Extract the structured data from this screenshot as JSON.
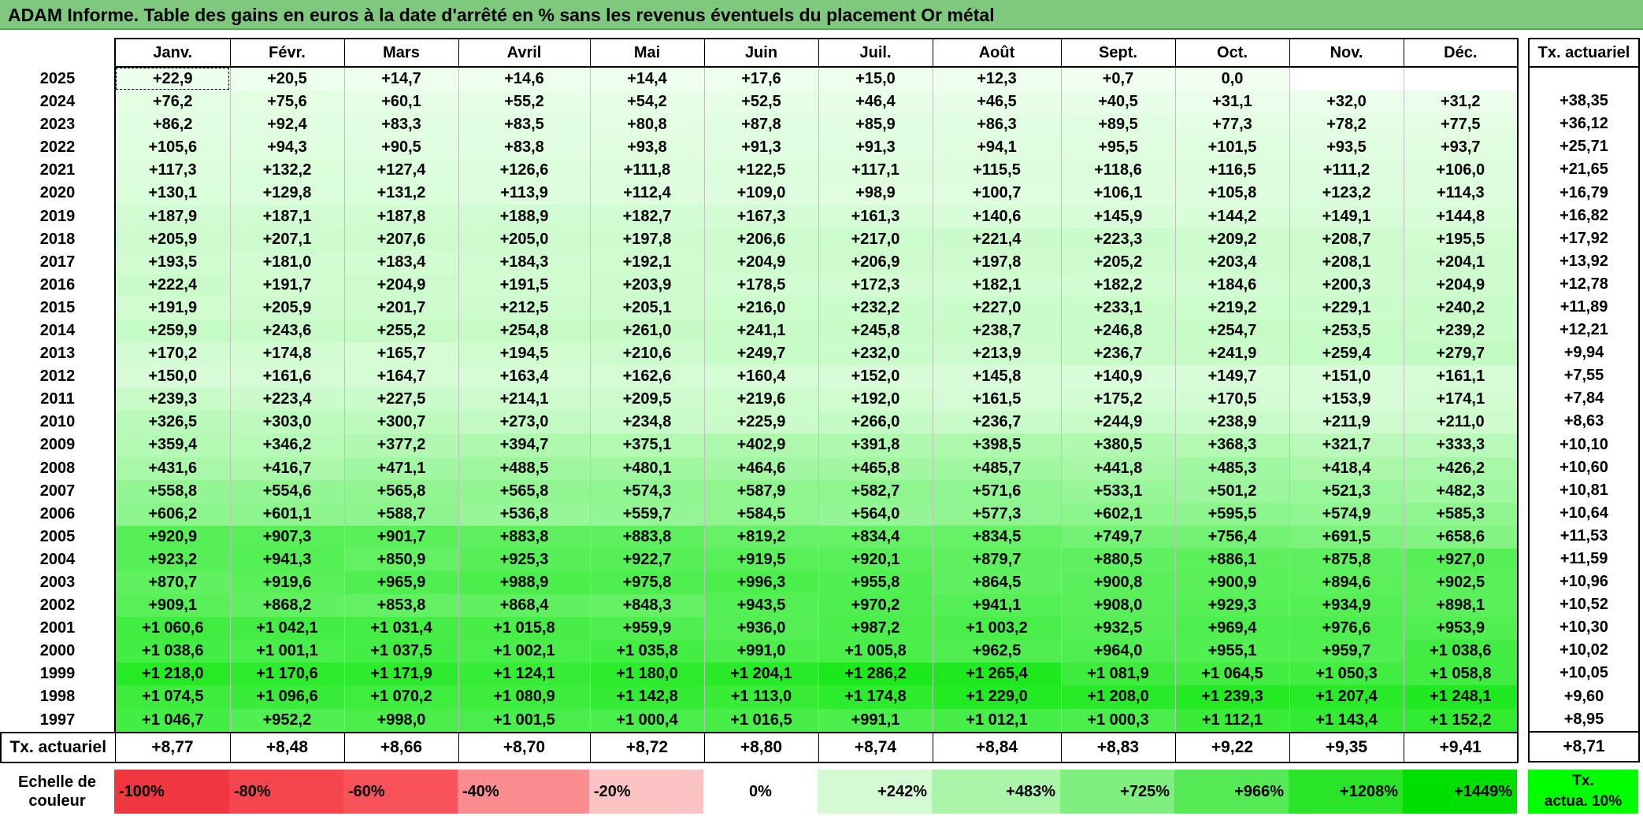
{
  "title": "ADAM Informe. Table des gains en euros à la date d'arrêté en % sans les revenus éventuels du placement Or métal",
  "months": [
    "Janv.",
    "Févr.",
    "Mars",
    "Avril",
    "Mai",
    "Juin",
    "Juil.",
    "Août",
    "Sept.",
    "Oct.",
    "Nov.",
    "Déc."
  ],
  "tx_header": "Tx. actuariel",
  "rows": [
    {
      "year": "2025",
      "v": [
        "+22,9",
        "+20,5",
        "+14,7",
        "+14,6",
        "+14,4",
        "+17,6",
        "+15,0",
        "+12,3",
        "+0,7",
        "0,0",
        "",
        ""
      ],
      "tx": ""
    },
    {
      "year": "2024",
      "v": [
        "+76,2",
        "+75,6",
        "+60,1",
        "+55,2",
        "+54,2",
        "+52,5",
        "+46,4",
        "+46,5",
        "+40,5",
        "+31,1",
        "+32,0",
        "+31,2"
      ],
      "tx": "+38,35"
    },
    {
      "year": "2023",
      "v": [
        "+86,2",
        "+92,4",
        "+83,3",
        "+83,5",
        "+80,8",
        "+87,8",
        "+85,9",
        "+86,3",
        "+89,5",
        "+77,3",
        "+78,2",
        "+77,5"
      ],
      "tx": "+36,12"
    },
    {
      "year": "2022",
      "v": [
        "+105,6",
        "+94,3",
        "+90,5",
        "+83,8",
        "+93,8",
        "+91,3",
        "+91,3",
        "+94,1",
        "+95,5",
        "+101,5",
        "+93,5",
        "+93,7"
      ],
      "tx": "+25,71"
    },
    {
      "year": "2021",
      "v": [
        "+117,3",
        "+132,2",
        "+127,4",
        "+126,6",
        "+111,8",
        "+122,5",
        "+117,1",
        "+115,5",
        "+118,6",
        "+116,5",
        "+111,2",
        "+106,0"
      ],
      "tx": "+21,65"
    },
    {
      "year": "2020",
      "v": [
        "+130,1",
        "+129,8",
        "+131,2",
        "+113,9",
        "+112,4",
        "+109,0",
        "+98,9",
        "+100,7",
        "+106,1",
        "+105,8",
        "+123,2",
        "+114,3"
      ],
      "tx": "+16,79"
    },
    {
      "year": "2019",
      "v": [
        "+187,9",
        "+187,1",
        "+187,8",
        "+188,9",
        "+182,7",
        "+167,3",
        "+161,3",
        "+140,6",
        "+145,9",
        "+144,2",
        "+149,1",
        "+144,8"
      ],
      "tx": "+16,82"
    },
    {
      "year": "2018",
      "v": [
        "+205,9",
        "+207,1",
        "+207,6",
        "+205,0",
        "+197,8",
        "+206,6",
        "+217,0",
        "+221,4",
        "+223,3",
        "+209,2",
        "+208,7",
        "+195,5"
      ],
      "tx": "+17,92"
    },
    {
      "year": "2017",
      "v": [
        "+193,5",
        "+181,0",
        "+183,4",
        "+184,3",
        "+192,1",
        "+204,9",
        "+206,9",
        "+197,8",
        "+205,2",
        "+203,4",
        "+208,1",
        "+204,1"
      ],
      "tx": "+13,92"
    },
    {
      "year": "2016",
      "v": [
        "+222,4",
        "+191,7",
        "+204,9",
        "+191,5",
        "+203,9",
        "+178,5",
        "+172,3",
        "+182,1",
        "+182,2",
        "+184,6",
        "+200,3",
        "+204,9"
      ],
      "tx": "+12,78"
    },
    {
      "year": "2015",
      "v": [
        "+191,9",
        "+205,9",
        "+201,7",
        "+212,5",
        "+205,1",
        "+216,0",
        "+232,2",
        "+227,0",
        "+233,1",
        "+219,2",
        "+229,1",
        "+240,2"
      ],
      "tx": "+11,89"
    },
    {
      "year": "2014",
      "v": [
        "+259,9",
        "+243,6",
        "+255,2",
        "+254,8",
        "+261,0",
        "+241,1",
        "+245,8",
        "+238,7",
        "+246,8",
        "+254,7",
        "+253,5",
        "+239,2"
      ],
      "tx": "+12,21"
    },
    {
      "year": "2013",
      "v": [
        "+170,2",
        "+174,8",
        "+165,7",
        "+194,5",
        "+210,6",
        "+249,7",
        "+232,0",
        "+213,9",
        "+236,7",
        "+241,9",
        "+259,4",
        "+279,7"
      ],
      "tx": "+9,94"
    },
    {
      "year": "2012",
      "v": [
        "+150,0",
        "+161,6",
        "+164,7",
        "+163,4",
        "+162,6",
        "+160,4",
        "+152,0",
        "+145,8",
        "+140,9",
        "+149,7",
        "+151,0",
        "+161,1"
      ],
      "tx": "+7,55"
    },
    {
      "year": "2011",
      "v": [
        "+239,3",
        "+223,4",
        "+227,5",
        "+214,1",
        "+209,5",
        "+219,6",
        "+192,0",
        "+161,5",
        "+175,2",
        "+170,5",
        "+153,9",
        "+174,1"
      ],
      "tx": "+7,84"
    },
    {
      "year": "2010",
      "v": [
        "+326,5",
        "+303,0",
        "+300,7",
        "+273,0",
        "+234,8",
        "+225,9",
        "+266,0",
        "+236,7",
        "+244,9",
        "+238,9",
        "+211,9",
        "+211,0"
      ],
      "tx": "+8,63"
    },
    {
      "year": "2009",
      "v": [
        "+359,4",
        "+346,2",
        "+377,2",
        "+394,7",
        "+375,1",
        "+402,9",
        "+391,8",
        "+398,5",
        "+380,5",
        "+368,3",
        "+321,7",
        "+333,3"
      ],
      "tx": "+10,10"
    },
    {
      "year": "2008",
      "v": [
        "+431,6",
        "+416,7",
        "+471,1",
        "+488,5",
        "+480,1",
        "+464,6",
        "+465,8",
        "+485,7",
        "+441,8",
        "+485,3",
        "+418,4",
        "+426,2"
      ],
      "tx": "+10,60"
    },
    {
      "year": "2007",
      "v": [
        "+558,8",
        "+554,6",
        "+565,8",
        "+565,8",
        "+574,3",
        "+587,9",
        "+582,7",
        "+571,6",
        "+533,1",
        "+501,2",
        "+521,3",
        "+482,3"
      ],
      "tx": "+10,81"
    },
    {
      "year": "2006",
      "v": [
        "+606,2",
        "+601,1",
        "+588,7",
        "+536,8",
        "+559,7",
        "+584,5",
        "+564,0",
        "+577,3",
        "+602,1",
        "+595,5",
        "+574,9",
        "+585,3"
      ],
      "tx": "+10,64"
    },
    {
      "year": "2005",
      "v": [
        "+920,9",
        "+907,3",
        "+901,7",
        "+883,8",
        "+883,8",
        "+819,2",
        "+834,4",
        "+834,5",
        "+749,7",
        "+756,4",
        "+691,5",
        "+658,6"
      ],
      "tx": "+11,53"
    },
    {
      "year": "2004",
      "v": [
        "+923,2",
        "+941,3",
        "+850,9",
        "+925,3",
        "+922,7",
        "+919,5",
        "+920,1",
        "+879,7",
        "+880,5",
        "+886,1",
        "+875,8",
        "+927,0"
      ],
      "tx": "+11,59"
    },
    {
      "year": "2003",
      "v": [
        "+870,7",
        "+919,6",
        "+965,9",
        "+988,9",
        "+975,8",
        "+996,3",
        "+955,8",
        "+864,5",
        "+900,8",
        "+900,9",
        "+894,6",
        "+902,5"
      ],
      "tx": "+10,96"
    },
    {
      "year": "2002",
      "v": [
        "+909,1",
        "+868,2",
        "+853,8",
        "+868,4",
        "+848,3",
        "+943,5",
        "+970,2",
        "+941,1",
        "+908,0",
        "+929,3",
        "+934,9",
        "+898,1"
      ],
      "tx": "+10,52"
    },
    {
      "year": "2001",
      "v": [
        "+1 060,6",
        "+1 042,1",
        "+1 031,4",
        "+1 015,8",
        "+959,9",
        "+936,0",
        "+987,2",
        "+1 003,2",
        "+932,5",
        "+969,4",
        "+976,6",
        "+953,9"
      ],
      "tx": "+10,30"
    },
    {
      "year": "2000",
      "v": [
        "+1 038,6",
        "+1 001,1",
        "+1 037,5",
        "+1 002,1",
        "+1 035,8",
        "+991,0",
        "+1 005,8",
        "+962,5",
        "+964,0",
        "+955,1",
        "+959,7",
        "+1 038,6"
      ],
      "tx": "+10,02"
    },
    {
      "year": "1999",
      "v": [
        "+1 218,0",
        "+1 170,6",
        "+1 171,9",
        "+1 124,1",
        "+1 180,0",
        "+1 204,1",
        "+1 286,2",
        "+1 265,4",
        "+1 081,9",
        "+1 064,5",
        "+1 050,3",
        "+1 058,8"
      ],
      "tx": "+10,05"
    },
    {
      "year": "1998",
      "v": [
        "+1 074,5",
        "+1 096,6",
        "+1 070,2",
        "+1 080,9",
        "+1 142,8",
        "+1 113,0",
        "+1 174,8",
        "+1 229,0",
        "+1 208,0",
        "+1 239,3",
        "+1 207,4",
        "+1 248,1"
      ],
      "tx": "+9,60"
    },
    {
      "year": "1997",
      "v": [
        "+1 046,7",
        "+952,2",
        "+998,0",
        "+1 001,5",
        "+1 000,4",
        "+1 016,5",
        "+991,1",
        "+1 012,1",
        "+1 000,3",
        "+1 112,1",
        "+1 143,4",
        "+1 152,2"
      ],
      "tx": "+8,95"
    }
  ],
  "bottom": {
    "label": "Tx. actuariel",
    "values": [
      "+8,77",
      "+8,48",
      "+8,66",
      "+8,70",
      "+8,72",
      "+8,80",
      "+8,74",
      "+8,84",
      "+8,83",
      "+9,22",
      "+9,35",
      "+9,41"
    ],
    "total": "+8,71"
  },
  "scale": {
    "label_line1": "Echelle de",
    "label_line2": "couleur",
    "items": [
      {
        "text": "-100%",
        "color": "#f0363e"
      },
      {
        "text": "-80%",
        "color": "#f5454d"
      },
      {
        "text": "-60%",
        "color": "#f8535a"
      },
      {
        "text": "-40%",
        "color": "#fb8c90"
      },
      {
        "text": "-20%",
        "color": "#fcc3c5"
      },
      {
        "text": "0%",
        "color": "#ffffff"
      },
      {
        "text": "+242%",
        "color": "#d4fad4"
      },
      {
        "text": "+483%",
        "color": "#aaf5aa"
      },
      {
        "text": "+725%",
        "color": "#7ff07f"
      },
      {
        "text": "+966%",
        "color": "#55ea55"
      },
      {
        "text": "+1208%",
        "color": "#2ae42a"
      },
      {
        "text": "+1449%",
        "color": "#00e000"
      }
    ],
    "tx_line1": "Tx.",
    "tx_line2": "actua. 10%",
    "tx_color": "#00ff00"
  }
}
